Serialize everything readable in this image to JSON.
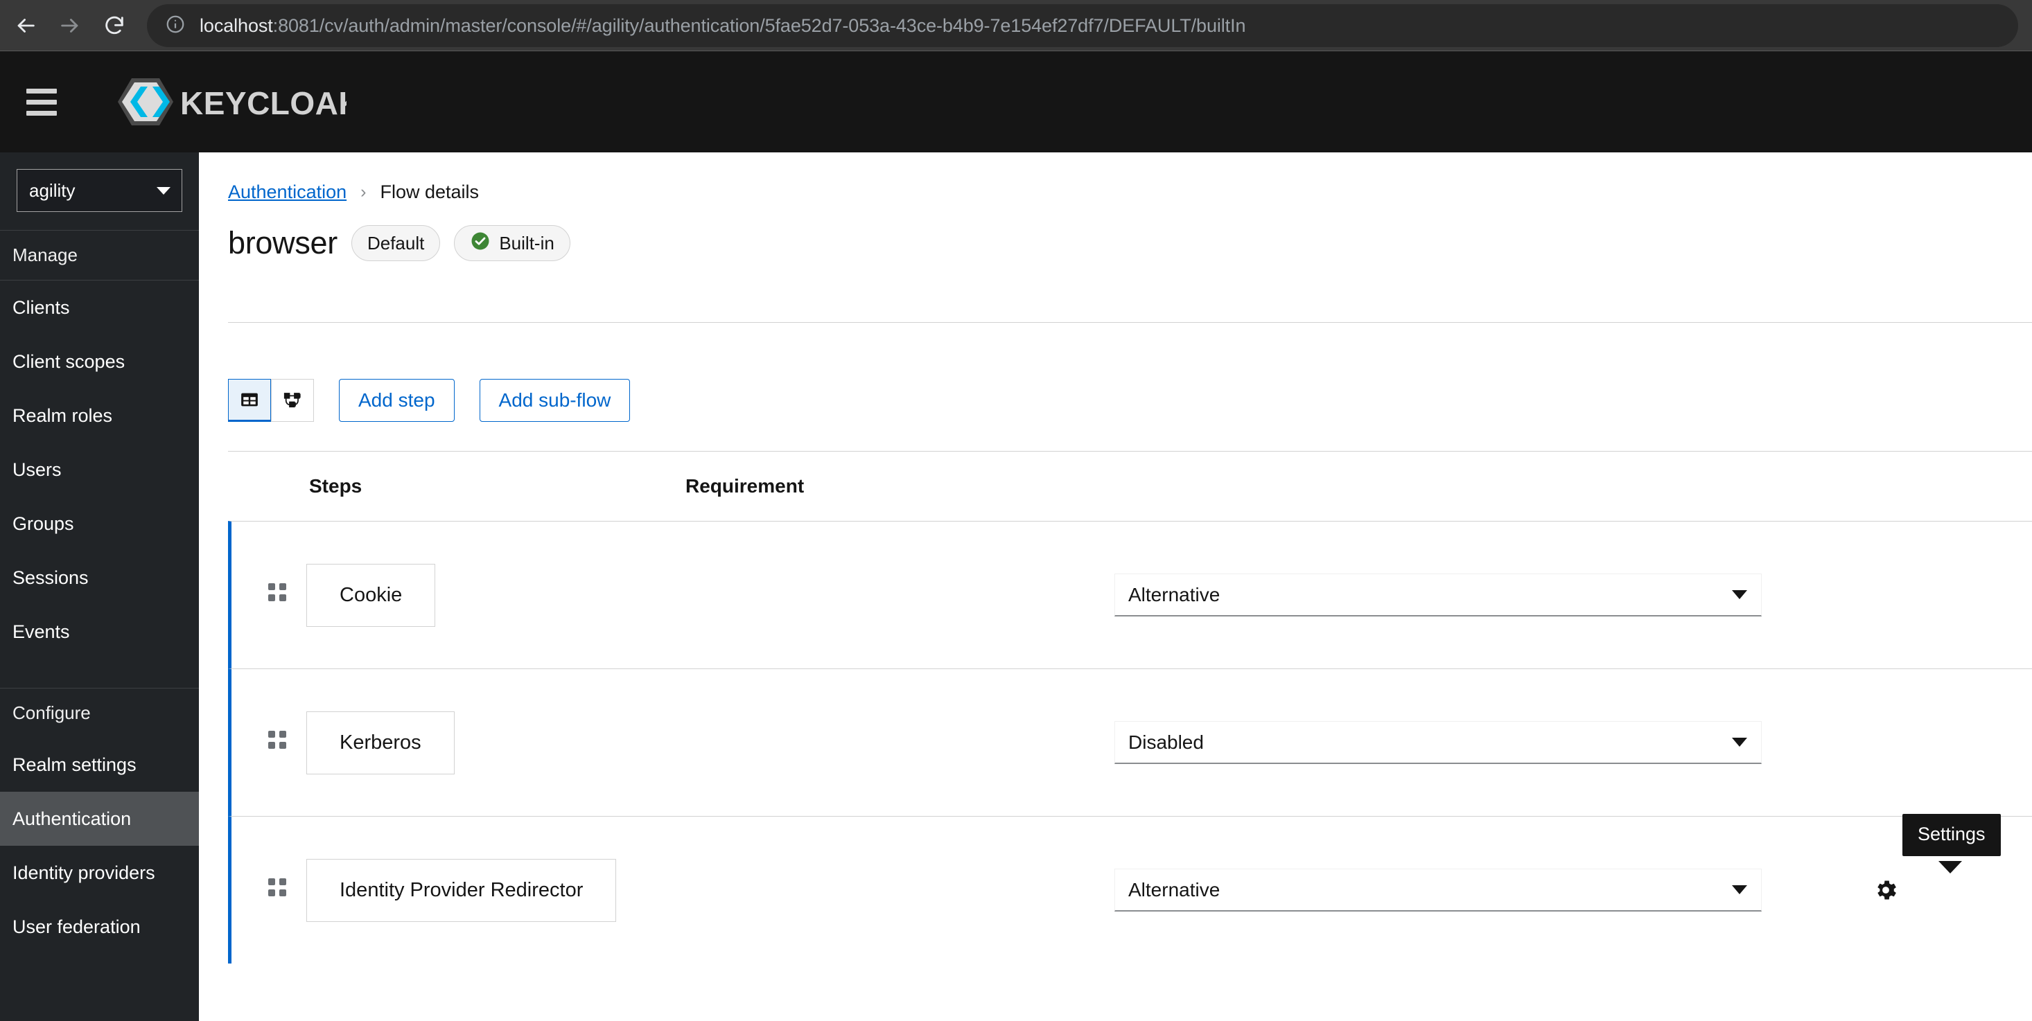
{
  "browser": {
    "back_icon": "back-arrow-icon",
    "forward_icon": "forward-arrow-icon",
    "reload_icon": "reload-icon",
    "site_info_icon": "site-info-icon",
    "url_host": "localhost",
    "url_rest": ":8081/cv/auth/admin/master/console/#/agility/authentication/5fae52d7-053a-43ce-b4b9-7e154ef27df7/DEFAULT/builtIn"
  },
  "masthead": {
    "hamburger_icon": "hamburger-menu-icon",
    "brand_name": "KEYCLOAK",
    "brand_logo_icon": "keycloak-logo-icon"
  },
  "sidebar": {
    "realm_selector": {
      "value": "agility",
      "caret_icon": "chevron-down-icon"
    },
    "groups": [
      {
        "title": "Manage",
        "items": [
          {
            "label": "Clients",
            "active": false
          },
          {
            "label": "Client scopes",
            "active": false
          },
          {
            "label": "Realm roles",
            "active": false
          },
          {
            "label": "Users",
            "active": false
          },
          {
            "label": "Groups",
            "active": false
          },
          {
            "label": "Sessions",
            "active": false
          },
          {
            "label": "Events",
            "active": false
          }
        ]
      },
      {
        "title": "Configure",
        "items": [
          {
            "label": "Realm settings",
            "active": false
          },
          {
            "label": "Authentication",
            "active": true
          },
          {
            "label": "Identity providers",
            "active": false
          },
          {
            "label": "User federation",
            "active": false
          }
        ]
      }
    ]
  },
  "main": {
    "breadcrumb": {
      "parent": "Authentication",
      "separator": "›",
      "current": "Flow details"
    },
    "title": "browser",
    "chips": [
      {
        "label": "Default",
        "has_check": false
      },
      {
        "label": "Built-in",
        "has_check": true
      }
    ],
    "toolbar": {
      "table_view_icon": "table-view-icon",
      "table_view_selected": true,
      "diagram_view_icon": "topology-diagram-icon",
      "diagram_view_selected": false,
      "add_step_label": "Add step",
      "add_subflow_label": "Add sub-flow"
    },
    "table": {
      "columns": [
        "Steps",
        "Requirement"
      ],
      "rows": [
        {
          "drag_handle_icon": "drag-handle-icon",
          "step": "Cookie",
          "requirement": "Alternative",
          "caret_icon": "chevron-down-icon",
          "has_gear": false
        },
        {
          "drag_handle_icon": "drag-handle-icon",
          "step": "Kerberos",
          "requirement": "Disabled",
          "caret_icon": "chevron-down-icon",
          "has_gear": false
        },
        {
          "drag_handle_icon": "drag-handle-icon",
          "step": "Identity Provider Redirector",
          "requirement": "Alternative",
          "caret_icon": "chevron-down-icon",
          "has_gear": true,
          "gear_icon": "gear-icon"
        }
      ]
    },
    "tooltip": {
      "text": "Settings"
    }
  },
  "colors": {
    "accent_blue": "#0066cc",
    "brand_cyan": "#00b8e6",
    "masthead_bg": "#151515",
    "sidebar_bg": "#212427",
    "sidebar_active": "#4f5255",
    "success_green": "#3e8635",
    "border_gray": "#d2d2d2"
  }
}
